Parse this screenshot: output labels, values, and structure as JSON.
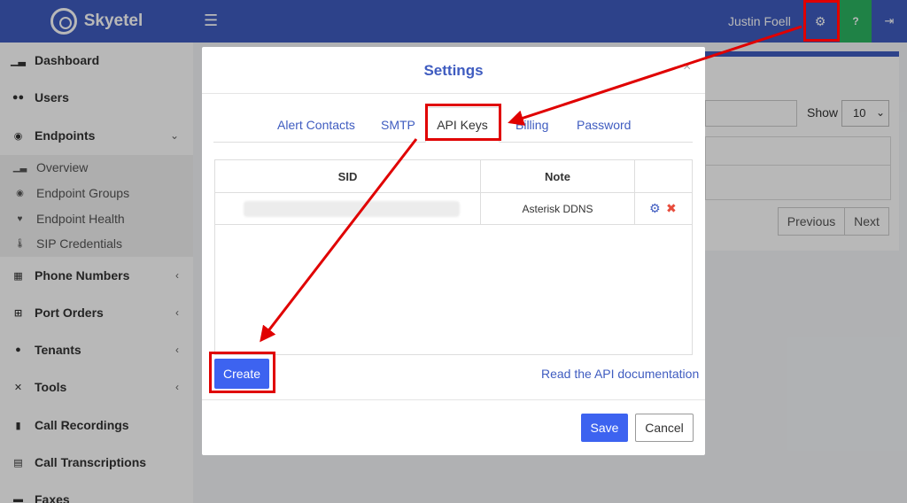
{
  "header": {
    "brand": "Skyetel",
    "menu_icon": "hamburger-icon",
    "user_name": "Justin Foell",
    "settings_icon": "gears-icon",
    "help_label": "?",
    "logout_icon": "sign-out-icon",
    "help_color": "#2bb462",
    "bar_color": "#3f5cc0"
  },
  "sidebar": {
    "items": [
      {
        "label": "Dashboard",
        "icon": "chart-icon"
      },
      {
        "label": "Users",
        "icon": "users-icon"
      },
      {
        "label": "Endpoints",
        "icon": "dot-circle-icon"
      },
      {
        "label": "Phone Numbers",
        "icon": "grid-icon"
      },
      {
        "label": "Port Orders",
        "icon": "plus-square-icon"
      },
      {
        "label": "Tenants",
        "icon": "user-icon"
      },
      {
        "label": "Tools",
        "icon": "tools-icon"
      },
      {
        "label": "Call Recordings",
        "icon": "microphone-icon"
      },
      {
        "label": "Call Transcriptions",
        "icon": "file-icon"
      },
      {
        "label": "Faxes",
        "icon": "fax-icon"
      }
    ],
    "endpoints_sub": [
      {
        "label": "Overview",
        "icon": "chart-icon"
      },
      {
        "label": "Endpoint Groups",
        "icon": "dot-circle-icon"
      },
      {
        "label": "Endpoint Health",
        "icon": "heart-icon"
      },
      {
        "label": "SIP Credentials",
        "icon": "thermometer-icon"
      }
    ]
  },
  "background": {
    "show_label": "Show",
    "show_value": "10",
    "previous": "Previous",
    "next": "Next"
  },
  "modal": {
    "title": "Settings",
    "close": "×",
    "tabs": [
      "Alert Contacts",
      "SMTP",
      "API Keys",
      "Billing",
      "Password"
    ],
    "active_tab": "API Keys",
    "table": {
      "headers": [
        "SID",
        "Note"
      ],
      "rows": [
        {
          "sid": "",
          "note": "Asterisk DDNS"
        }
      ]
    },
    "create_label": "Create",
    "doc_link": "Read the API documentation",
    "save_label": "Save",
    "cancel_label": "Cancel",
    "accent": "#3d63f0"
  },
  "annotation_color": "#e00000"
}
